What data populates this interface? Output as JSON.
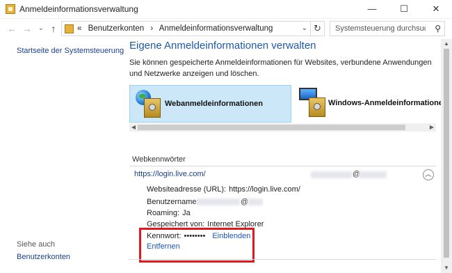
{
  "window": {
    "title": "Anmeldeinformationsverwaltung",
    "minimize": "—",
    "maximize": "☐",
    "close": "✕"
  },
  "nav": {
    "back": "←",
    "forward": "→",
    "dropdown": "⌄",
    "up": "↑"
  },
  "breadcrumb": {
    "prefix": "«",
    "items": [
      "Benutzerkonten",
      "›",
      "Anmeldeinformationsverwaltung"
    ]
  },
  "search": {
    "placeholder": "Systemsteuerung durchsuchen"
  },
  "sidebar": {
    "home_link": "Startseite der Systemsteuerung",
    "see_also": "Siehe auch",
    "accounts_link": "Benutzerkonten"
  },
  "main": {
    "title": "Eigene Anmeldeinformationen verwalten",
    "description": "Sie können gespeicherte Anmeldeinformationen für Websites, verbundene Anwendungen und Netzwerke anzeigen und löschen.",
    "categories": [
      "Webanmeldeinformationen",
      "Windows-Anmeldeinformationen"
    ],
    "section_title": "Webkennwörter",
    "entry": {
      "url": "https://login.live.com/",
      "account_at": "@",
      "details": {
        "website_label": "Websiteadresse (URL):",
        "website_value": "https://login.live.com/",
        "username_label": "Benutzername:",
        "username_at": "@",
        "roaming_label": "Roaming:",
        "roaming_value": "Ja",
        "saved_by_label": "Gespeichert von:",
        "saved_by_value": "Internet Explorer",
        "password_label": "Kennwort:",
        "password_value": "••••••••",
        "show_link": "Einblenden",
        "remove_link": "Entfernen"
      }
    }
  },
  "colors": {
    "accent": "#1e5aa8",
    "link": "#1a56b8",
    "selected_tile": "#cce8f8",
    "highlight_box": "#e0191e"
  }
}
